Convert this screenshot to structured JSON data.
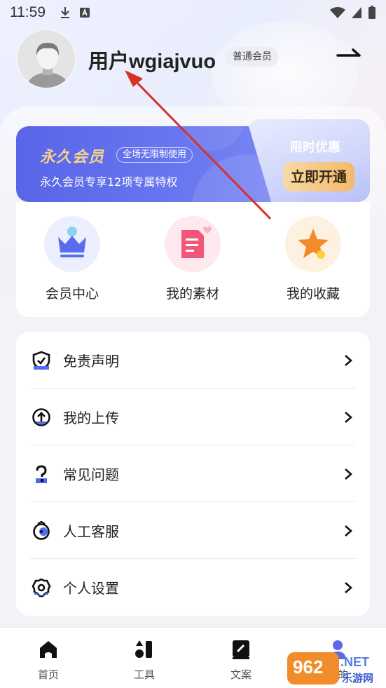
{
  "status_bar": {
    "time": "11:59"
  },
  "profile": {
    "username": "用户wgiajvuo",
    "member_level": "普通会员"
  },
  "vip_banner": {
    "title": "永久会员",
    "tag": "全场无限制使用",
    "subtitle": "永久会员专享12项专属特权",
    "limited_offer": "限时优惠",
    "open_button": "立即开通"
  },
  "quick_actions": [
    {
      "label": "会员中心",
      "icon": "crown-icon"
    },
    {
      "label": "我的素材",
      "icon": "document-heart-icon"
    },
    {
      "label": "我的收藏",
      "icon": "star-icon"
    }
  ],
  "menu": [
    {
      "label": "免责声明",
      "icon": "shield-check-icon"
    },
    {
      "label": "我的上传",
      "icon": "upload-icon"
    },
    {
      "label": "常见问题",
      "icon": "question-icon"
    },
    {
      "label": "人工客服",
      "icon": "customer-service-icon"
    },
    {
      "label": "个人设置",
      "icon": "settings-icon"
    }
  ],
  "bottom_nav": [
    {
      "label": "首页",
      "icon": "home-icon"
    },
    {
      "label": "工具",
      "icon": "tools-icon"
    },
    {
      "label": "文案",
      "icon": "copywriting-icon"
    },
    {
      "label": "我的",
      "icon": "profile-icon",
      "active": true
    }
  ],
  "watermark": {
    "text_top": "962.NET",
    "text_bottom": "乐游网"
  },
  "colors": {
    "accent": "#5b68e9",
    "vip_gold": "#f6d28b",
    "annotation_red": "#d8302a"
  }
}
